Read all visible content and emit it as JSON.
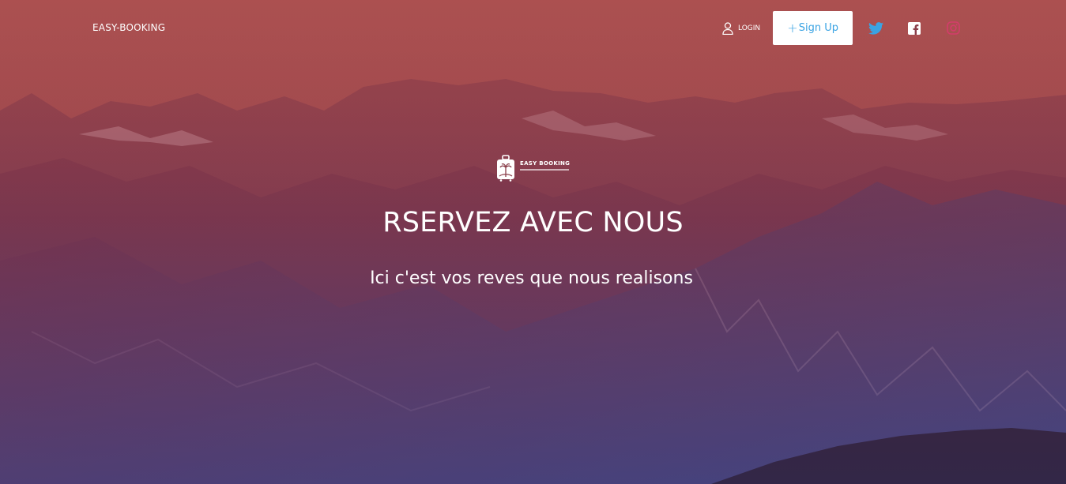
{
  "header": {
    "brand": "EASY-BOOKING",
    "login_label": "LOGIN",
    "signup_label": "Sign Up",
    "signup_prefix": "+"
  },
  "social": {
    "twitter": "twitter-icon",
    "facebook": "facebook-icon",
    "instagram": "instagram-icon"
  },
  "logo": {
    "text": "EASY BOOKING"
  },
  "hero": {
    "title": "RSERVEZ AVEC NOUS",
    "subtitle": "Ici c'est vos reves que nous realisons"
  },
  "colors": {
    "signup_text": "#3aa3e3",
    "twitter": "#3aa3e3",
    "instagram": "#d43c6b"
  }
}
